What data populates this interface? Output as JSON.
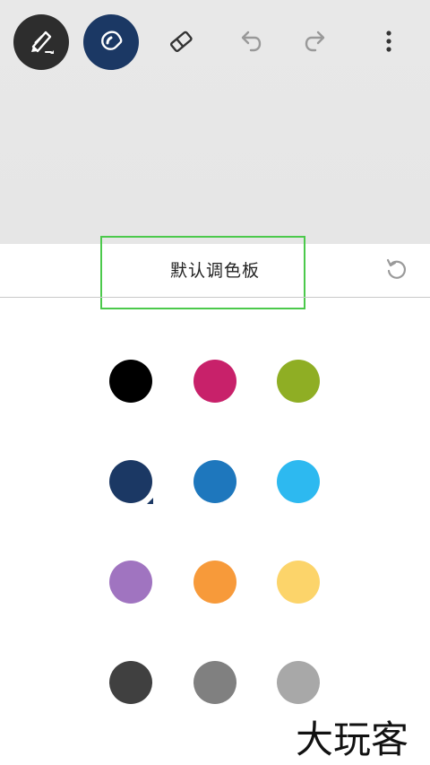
{
  "toolbar": {
    "tools": [
      {
        "name": "pen",
        "icon": "pen-icon"
      },
      {
        "name": "ink-drop",
        "icon": "ink-drop-icon"
      },
      {
        "name": "eraser",
        "icon": "eraser-icon"
      },
      {
        "name": "undo",
        "icon": "undo-icon"
      },
      {
        "name": "redo",
        "icon": "redo-icon"
      },
      {
        "name": "more",
        "icon": "more-vertical-icon"
      }
    ]
  },
  "palette": {
    "title": "默认调色板",
    "reset_icon": "reset-icon",
    "selected_index": 3,
    "colors": [
      "#000000",
      "#c8216a",
      "#8fae24",
      "#1b3864",
      "#1e77bd",
      "#2db9f0",
      "#a074c0",
      "#f79a3a",
      "#fcd46a",
      "#404040",
      "#808080",
      "#a8a8a8"
    ]
  },
  "watermark": "大玩客",
  "colors": {
    "canvas": "#e7e7e7",
    "pen_button": "#2d2d2d",
    "ink_button": "#1b3864",
    "highlight": "#4bc94b"
  }
}
